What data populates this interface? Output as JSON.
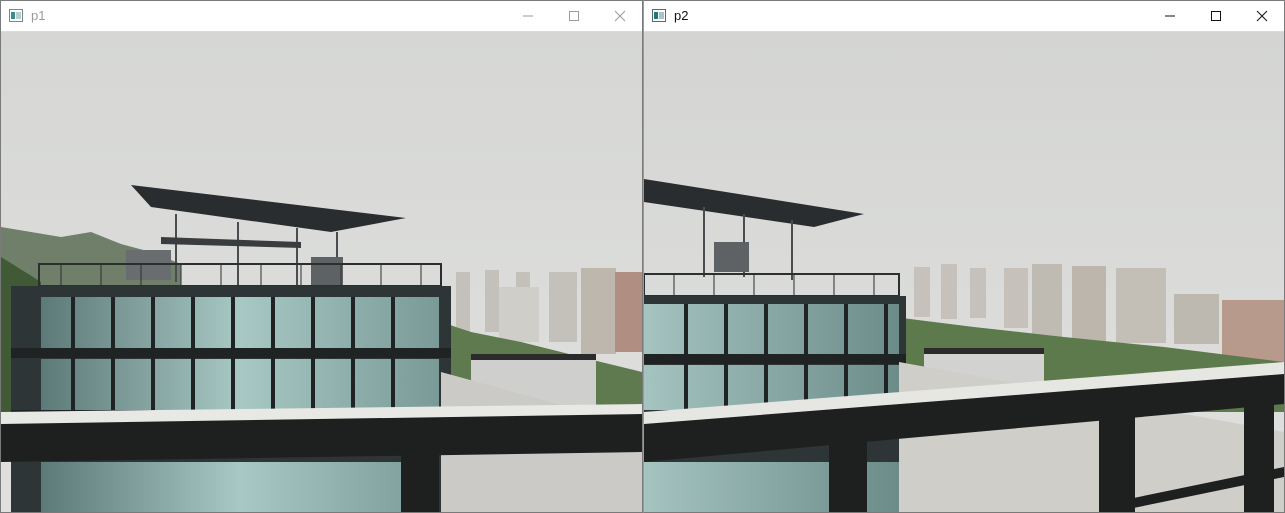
{
  "windows": [
    {
      "title": "p1",
      "icon": "image-window-icon",
      "active": false,
      "controls": [
        "minimize-icon",
        "maximize-icon",
        "close-icon"
      ]
    },
    {
      "title": "p2",
      "icon": "image-window-icon",
      "active": true,
      "controls": [
        "minimize-icon",
        "maximize-icon",
        "close-icon"
      ]
    }
  ],
  "colors": {
    "sky": "#dcdddb",
    "railing": "#1e201f",
    "glass": "#8fb3b0",
    "hills": "#556b50",
    "tower": "#c9c6c0"
  }
}
